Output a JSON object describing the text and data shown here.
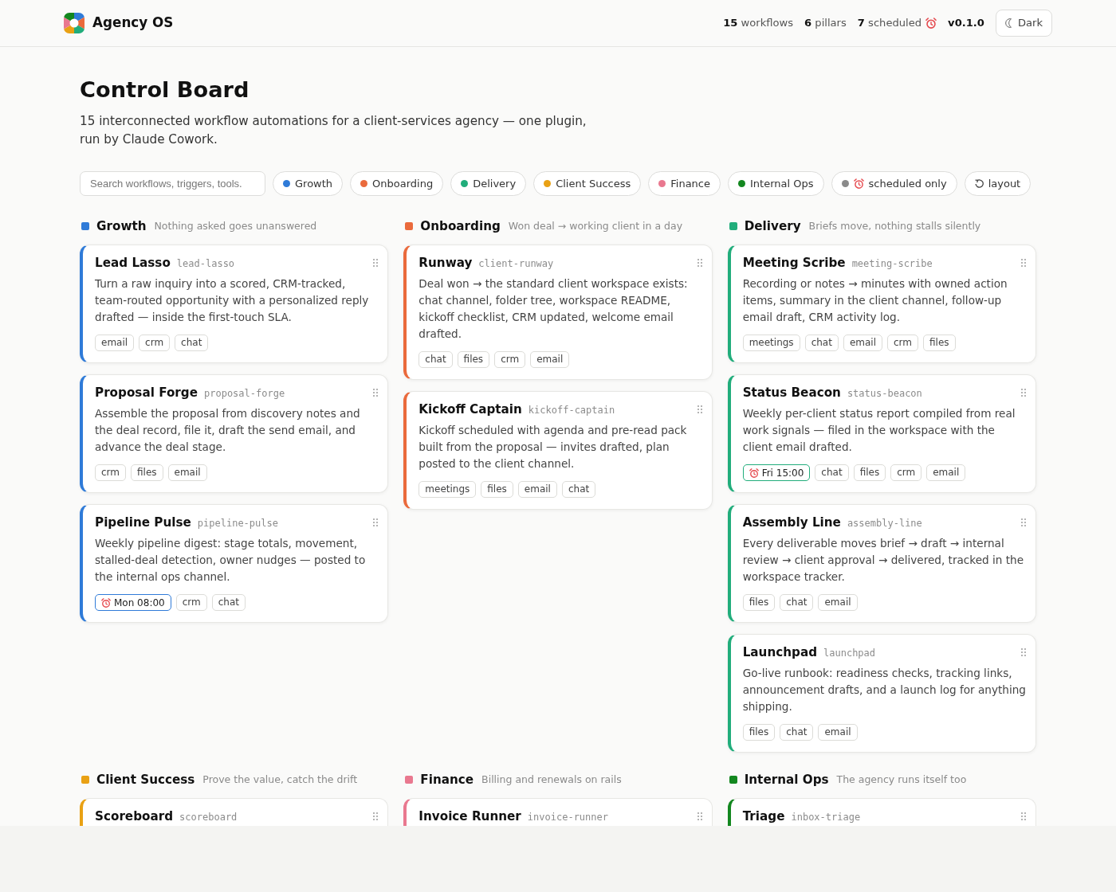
{
  "app": {
    "name": "Agency OS",
    "stats": [
      {
        "text": "**15** workflows",
        "kind": "count"
      },
      {
        "text": "**6** pillars",
        "kind": "count"
      },
      {
        "text": "**7** scheduled",
        "kind": "scheduled"
      }
    ],
    "version": "v0.1.0",
    "theme_button": {
      "label": "Dark"
    }
  },
  "page": {
    "title": "Control Board",
    "subtitle": "15 interconnected workflow automations for a client-services agency — one plugin, run by Claude Cowork."
  },
  "filters": {
    "search": {
      "placeholder": "Search workflows, triggers, tools."
    },
    "pills": [
      {
        "label": "Growth",
        "kind": "pillar",
        "color": "#2f7bd8"
      },
      {
        "label": "Onboarding",
        "kind": "pillar",
        "color": "#ea6a3c"
      },
      {
        "label": "Delivery",
        "kind": "pillar",
        "color": "#21ad7b"
      },
      {
        "label": "Client Success",
        "kind": "pillar",
        "color": "#e9a114"
      },
      {
        "label": "Finance",
        "kind": "pillar",
        "color": "#e9788f"
      },
      {
        "label": "Internal Ops",
        "kind": "pillar",
        "color": "#13871f"
      },
      {
        "label": "scheduled only",
        "kind": "scheduled",
        "color": "#8a8a8a"
      },
      {
        "label": "layout",
        "kind": "reset"
      }
    ]
  },
  "sections": [
    {
      "name": "Growth",
      "tagline": "Nothing asked goes unanswered",
      "color": "#2f7bd8",
      "cards": [
        {
          "title": "Lead Lasso",
          "slug": "lead-lasso",
          "description": "Turn a raw inquiry into a scored, CRM-tracked, team-routed opportunity with a personalized reply drafted — inside the first-touch SLA.",
          "tags": [
            "email",
            "crm",
            "chat"
          ]
        },
        {
          "title": "Proposal Forge",
          "slug": "proposal-forge",
          "description": "Assemble the proposal from discovery notes and the deal record, file it, draft the send email, and advance the deal stage.",
          "tags": [
            "crm",
            "files",
            "email"
          ]
        },
        {
          "title": "Pipeline Pulse",
          "slug": "pipeline-pulse",
          "description": "Weekly pipeline digest: stage totals, movement, stalled-deal detection, owner nudges — posted to the internal ops channel.",
          "schedule": "Mon 08:00",
          "tags": [
            "crm",
            "chat"
          ]
        }
      ]
    },
    {
      "name": "Onboarding",
      "tagline": "Won deal → working client in a day",
      "color": "#ea6a3c",
      "cards": [
        {
          "title": "Runway",
          "slug": "client-runway",
          "description": "Deal won → the standard client workspace exists: chat channel, folder tree, workspace README, kickoff checklist, CRM updated, welcome email drafted.",
          "tags": [
            "chat",
            "files",
            "crm",
            "email"
          ]
        },
        {
          "title": "Kickoff Captain",
          "slug": "kickoff-captain",
          "description": "Kickoff scheduled with agenda and pre-read pack built from the proposal — invites drafted, plan posted to the client channel.",
          "tags": [
            "meetings",
            "files",
            "email",
            "chat"
          ]
        }
      ]
    },
    {
      "name": "Delivery",
      "tagline": "Briefs move, nothing stalls silently",
      "color": "#21ad7b",
      "cards": [
        {
          "title": "Meeting Scribe",
          "slug": "meeting-scribe",
          "description": "Recording or notes → minutes with owned action items, summary in the client channel, follow-up email draft, CRM activity log.",
          "tags": [
            "meetings",
            "chat",
            "email",
            "crm",
            "files"
          ]
        },
        {
          "title": "Status Beacon",
          "slug": "status-beacon",
          "description": "Weekly per-client status report compiled from real work signals — filed in the workspace with the client email drafted.",
          "schedule": "Fri 15:00",
          "tags": [
            "chat",
            "files",
            "crm",
            "email"
          ]
        },
        {
          "title": "Assembly Line",
          "slug": "assembly-line",
          "description": "Every deliverable moves brief → draft → internal review → client approval → delivered, tracked in the workspace tracker.",
          "tags": [
            "files",
            "chat",
            "email"
          ]
        },
        {
          "title": "Launchpad",
          "slug": "launchpad",
          "description": "Go-live runbook: readiness checks, tracking links, announcement drafts, and a launch log for anything shipping.",
          "tags": [
            "files",
            "chat",
            "email"
          ]
        }
      ]
    },
    {
      "name": "Client Success",
      "tagline": "Prove the value, catch the drift",
      "color": "#e9a114",
      "cards": [
        {
          "title": "Scoreboard",
          "slug": "scoreboard"
        }
      ]
    },
    {
      "name": "Finance",
      "tagline": "Billing and renewals on rails",
      "color": "#e9788f",
      "cards": [
        {
          "title": "Invoice Runner",
          "slug": "invoice-runner"
        }
      ]
    },
    {
      "name": "Internal Ops",
      "tagline": "The agency runs itself too",
      "color": "#13871f",
      "cards": [
        {
          "title": "Triage",
          "slug": "inbox-triage"
        }
      ]
    }
  ]
}
